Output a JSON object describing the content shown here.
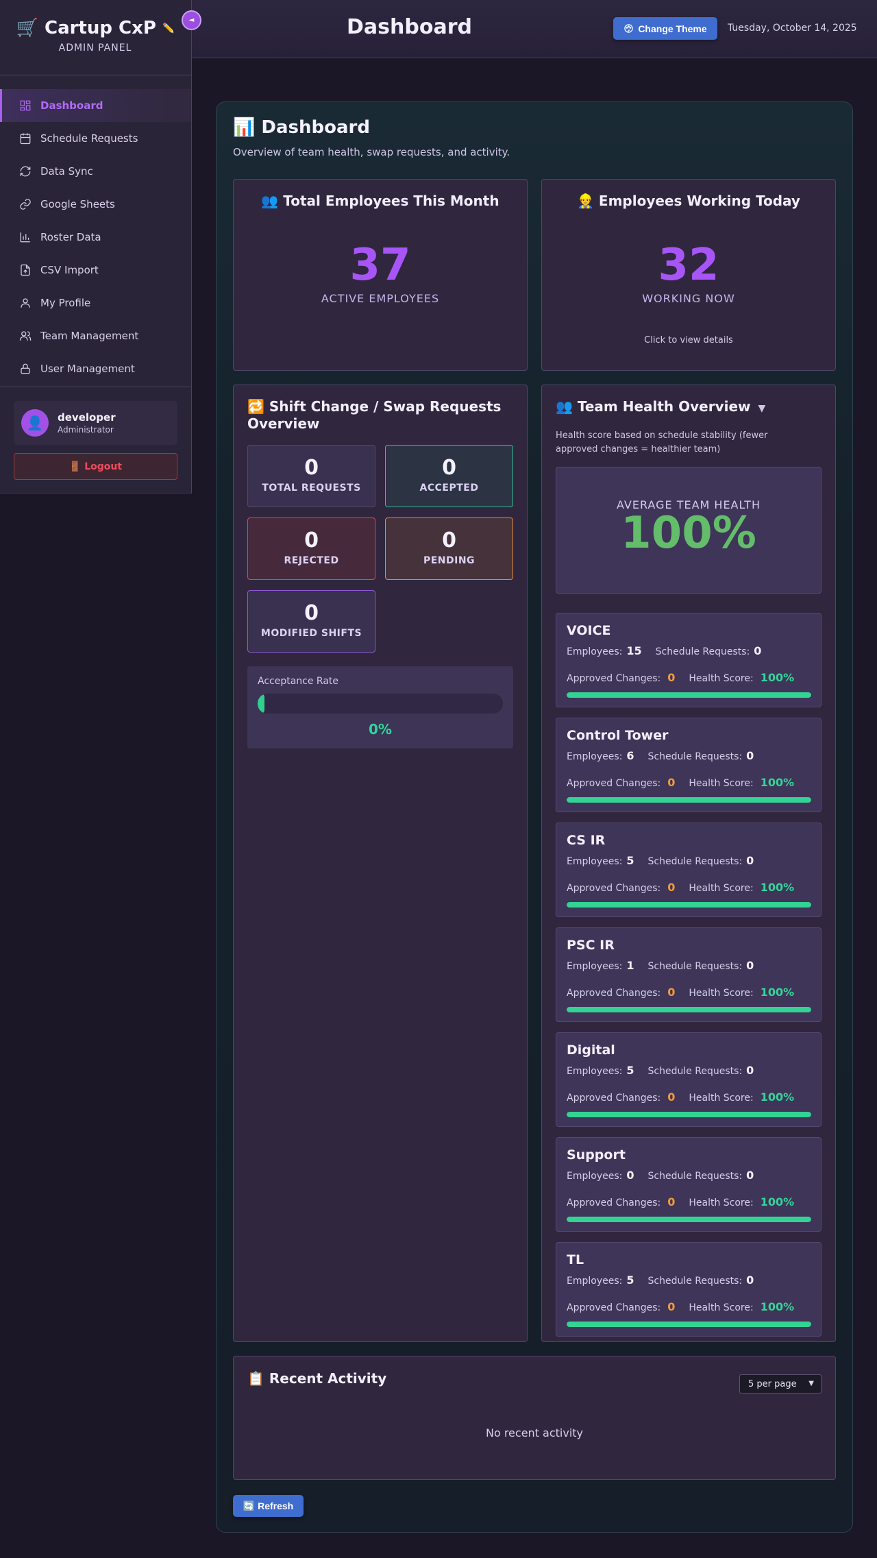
{
  "header": {
    "title": "Dashboard",
    "theme_button": "Change Theme",
    "date": "Tuesday, October 14, 2025"
  },
  "sidebar": {
    "brand_icon": "🛒",
    "brand_name": "Cartup CxP",
    "brand_sub": "ADMIN PANEL",
    "collapse_glyph": "◄",
    "items": [
      {
        "label": "Dashboard",
        "icon": "dashboard-icon"
      },
      {
        "label": "Schedule Requests",
        "icon": "calendar-icon"
      },
      {
        "label": "Data Sync",
        "icon": "sync-icon"
      },
      {
        "label": "Google Sheets",
        "icon": "link-icon"
      },
      {
        "label": "Roster Data",
        "icon": "bar-chart-icon"
      },
      {
        "label": "CSV Import",
        "icon": "file-upload-icon"
      },
      {
        "label": "My Profile",
        "icon": "user-icon"
      },
      {
        "label": "Team Management",
        "icon": "users-icon"
      },
      {
        "label": "User Management",
        "icon": "lock-icon"
      }
    ],
    "user": {
      "name": "developer",
      "role": "Administrator"
    },
    "logout": "🚪 Logout"
  },
  "main": {
    "title": "📊 Dashboard",
    "subtitle": "Overview of team health, swap requests, and activity.",
    "total_employees": {
      "title": "👥 Total Employees This Month",
      "value": "37",
      "label": "ACTIVE EMPLOYEES"
    },
    "working_today": {
      "title": "👷 Employees Working Today",
      "value": "32",
      "label": "WORKING NOW",
      "hint": "Click to view details"
    },
    "swap": {
      "title": "🔁 Shift Change / Swap Requests Overview",
      "total": {
        "value": "0",
        "label": "TOTAL REQUESTS"
      },
      "accepted": {
        "value": "0",
        "label": "ACCEPTED"
      },
      "rejected": {
        "value": "0",
        "label": "REJECTED"
      },
      "pending": {
        "value": "0",
        "label": "PENDING"
      },
      "modified": {
        "value": "0",
        "label": "MODIFIED SHIFTS"
      },
      "acceptance_label": "Acceptance Rate",
      "acceptance_rate": 0,
      "acceptance_text": "0%"
    },
    "team_health": {
      "title": "👥 Team Health Overview",
      "toggle": "▼",
      "description": "Health score based on schedule stability (fewer approved changes = healthier team)",
      "avg_label": "AVERAGE TEAM HEALTH",
      "avg_value": "100%",
      "row_labels": {
        "employees": "Employees:",
        "requests": "Schedule Requests:",
        "approved": "Approved Changes:",
        "health": "Health Score:"
      },
      "teams": [
        {
          "name": "VOICE",
          "employees": "15",
          "requests": "0",
          "approved": "0",
          "health": "100%",
          "health_value": 100
        },
        {
          "name": "Control Tower",
          "employees": "6",
          "requests": "0",
          "approved": "0",
          "health": "100%",
          "health_value": 100
        },
        {
          "name": "CS IR",
          "employees": "5",
          "requests": "0",
          "approved": "0",
          "health": "100%",
          "health_value": 100
        },
        {
          "name": "PSC IR",
          "employees": "1",
          "requests": "0",
          "approved": "0",
          "health": "100%",
          "health_value": 100
        },
        {
          "name": "Digital",
          "employees": "5",
          "requests": "0",
          "approved": "0",
          "health": "100%",
          "health_value": 100
        },
        {
          "name": "Support",
          "employees": "0",
          "requests": "0",
          "approved": "0",
          "health": "100%",
          "health_value": 100
        },
        {
          "name": "TL",
          "employees": "5",
          "requests": "0",
          "approved": "0",
          "health": "100%",
          "health_value": 100
        }
      ]
    },
    "recent": {
      "title": "📋 Recent Activity",
      "per_page": "5 per page",
      "empty": "No recent activity"
    },
    "refresh": "🔄 Refresh"
  },
  "colors": {
    "accent": "#a855f7",
    "success": "#2fcf8f",
    "warning": "#f29a3c",
    "danger": "#ef4c5b",
    "primary_button": "#3f6ccf"
  }
}
